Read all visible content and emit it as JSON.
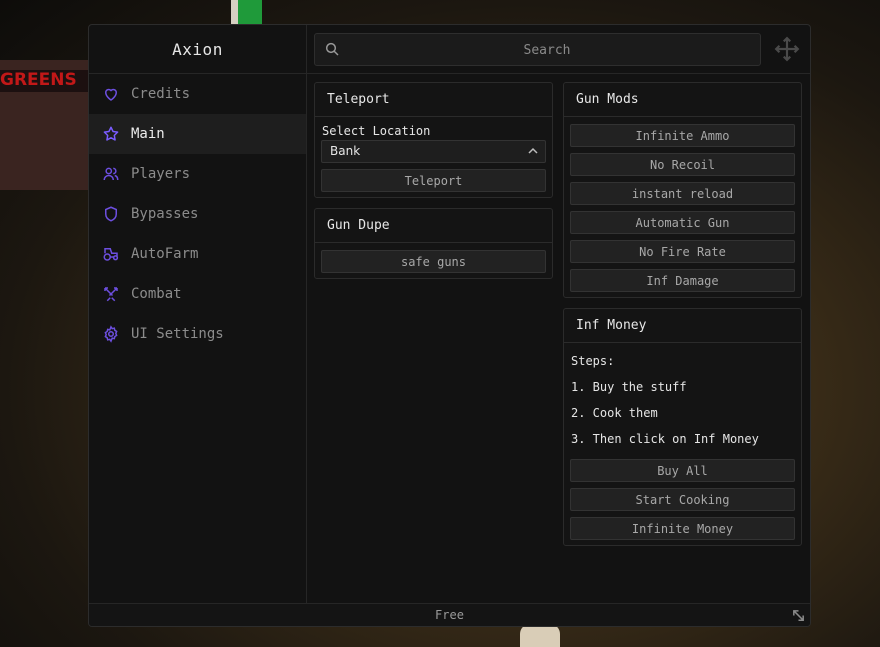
{
  "background": {
    "sign_text": "GREENS"
  },
  "app": {
    "title": "Axion",
    "footer": "Free",
    "accent": "#7a5cff"
  },
  "search": {
    "placeholder": "Search"
  },
  "sidebar": {
    "items": [
      {
        "label": "Credits",
        "icon": "heart-icon"
      },
      {
        "label": "Main",
        "icon": "star-icon",
        "active": true
      },
      {
        "label": "Players",
        "icon": "users-icon"
      },
      {
        "label": "Bypasses",
        "icon": "shield-icon"
      },
      {
        "label": "AutoFarm",
        "icon": "tractor-icon"
      },
      {
        "label": "Combat",
        "icon": "swords-icon"
      },
      {
        "label": "UI Settings",
        "icon": "gear-icon"
      }
    ]
  },
  "teleport": {
    "title": "Teleport",
    "select_label": "Select Location",
    "selected": "Bank",
    "button": "Teleport"
  },
  "gun_dupe": {
    "title": "Gun Dupe",
    "button": "safe guns"
  },
  "gun_mods": {
    "title": "Gun Mods",
    "buttons": [
      "Infinite Ammo",
      "No Recoil",
      "instant reload",
      "Automatic Gun",
      "No Fire Rate",
      "Inf Damage"
    ]
  },
  "inf_money": {
    "title": "Inf Money",
    "steps": [
      "Steps:",
      "1. Buy the stuff",
      "2. Cook them",
      "3. Then click on Inf Money"
    ],
    "buttons": [
      "Buy All",
      "Start Cooking",
      "Infinite Money"
    ]
  }
}
